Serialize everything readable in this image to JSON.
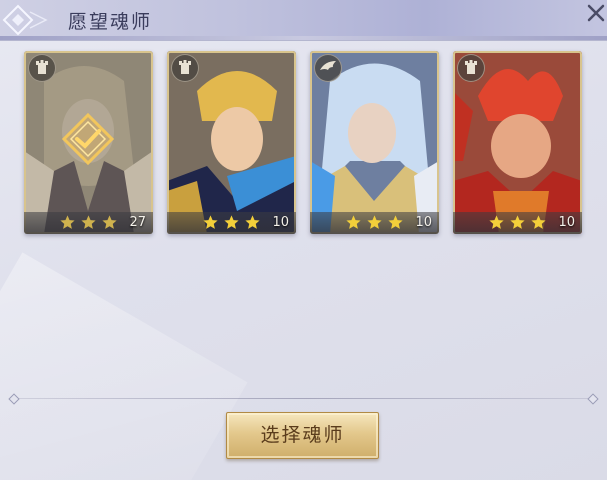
{
  "dialog": {
    "title": "愿望魂师",
    "select_button_label": "选择魂师"
  },
  "cards": [
    {
      "stars": 3,
      "level": "27",
      "selected": true,
      "role_icon": "tower-icon"
    },
    {
      "stars": 3,
      "level": "10",
      "selected": false,
      "role_icon": "tower-icon"
    },
    {
      "stars": 3,
      "level": "10",
      "selected": false,
      "role_icon": "wing-icon"
    },
    {
      "stars": 3,
      "level": "10",
      "selected": false,
      "role_icon": "tower-icon"
    }
  ],
  "colors": {
    "star": "#f3cf3a",
    "button_text": "#5a3c1c",
    "title_text": "#3a3c5c"
  }
}
